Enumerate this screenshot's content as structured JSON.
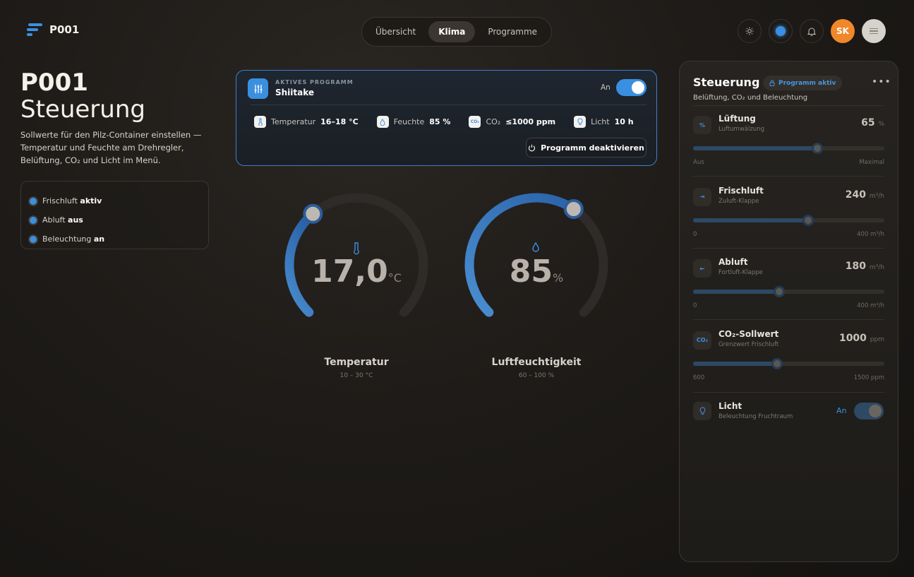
{
  "header": {
    "brand": "P001",
    "tabs": [
      {
        "label": "Übersicht",
        "active": false
      },
      {
        "label": "Klima",
        "active": true
      },
      {
        "label": "Programme",
        "active": false
      }
    ],
    "avatar_initials": "SK",
    "accent": "#3b8fe0",
    "avatar_color": "#f0882a"
  },
  "page": {
    "title_line1": "P001",
    "title_line2": "Steuerung",
    "description": "Sollwerte für den Pilz-Container einstellen — Temperatur und Feuchte am Drehregler, Belüftung, CO₂ und Licht im Menü."
  },
  "status": [
    {
      "label": "Frischluft",
      "value": "aktiv"
    },
    {
      "label": "Abluft",
      "value": "aus"
    },
    {
      "label": "Beleuchtung",
      "value": "an"
    }
  ],
  "program": {
    "label": "AKTIVES PROGRAMM",
    "name": "Shiitake",
    "toggle_label": "An",
    "enabled": true,
    "stats": [
      {
        "icon": "thermometer-icon",
        "label": "Temperatur",
        "value": "16–18 °C"
      },
      {
        "icon": "droplet-icon",
        "label": "Feuchte",
        "value": "85 %"
      },
      {
        "icon": "co2-icon",
        "label": "CO₂",
        "value": "≤1000 ppm"
      },
      {
        "icon": "bulb-icon",
        "label": "Licht",
        "value": "10 h"
      }
    ],
    "deactivate_label": "Programm deaktivieren"
  },
  "gauges": [
    {
      "id": "temperature",
      "value_text": "17,0",
      "unit": "°C",
      "title": "Temperatur",
      "range": "10 – 30 °C",
      "min": 10,
      "max": 30,
      "value": 17.0
    },
    {
      "id": "humidity",
      "value_text": "85",
      "unit": "%",
      "title": "Luftfeuchtigkeit",
      "range": "60 – 100 %",
      "min": 60,
      "max": 100,
      "value": 85
    }
  ],
  "panel": {
    "title": "Steuerung",
    "badge": "Programm aktiv",
    "subtitle": "Belüftung, CO₂ und Beleuchtung",
    "controls": [
      {
        "name": "Lüftung",
        "sub": "Luftumwälzung",
        "value": "65",
        "unit": "%",
        "min_label": "Aus",
        "max_label": "Maximal",
        "fraction": 0.65,
        "icon": "fan-icon",
        "icon_text": "%"
      },
      {
        "name": "Frischluft",
        "sub": "Zuluft-Klappe",
        "value": "240",
        "unit": "m³/h",
        "min_label": "0",
        "max_label": "400 m³/h",
        "fraction": 0.6,
        "icon": "inlet-icon",
        "icon_text": "⇥"
      },
      {
        "name": "Abluft",
        "sub": "Fortluft-Klappe",
        "value": "180",
        "unit": "m³/h",
        "min_label": "0",
        "max_label": "400 m³/h",
        "fraction": 0.45,
        "icon": "outlet-icon",
        "icon_text": "⇤"
      },
      {
        "name": "CO₂-Sollwert",
        "sub": "Grenzwert Frischluft",
        "value": "1000",
        "unit": "ppm",
        "min_label": "600",
        "max_label": "1500 ppm",
        "fraction": 0.44,
        "icon": "co2-icon",
        "icon_text": "CO₂"
      }
    ],
    "light": {
      "name": "Licht",
      "sub": "Beleuchtung Fruchtraum",
      "state": "An",
      "on": true
    }
  }
}
